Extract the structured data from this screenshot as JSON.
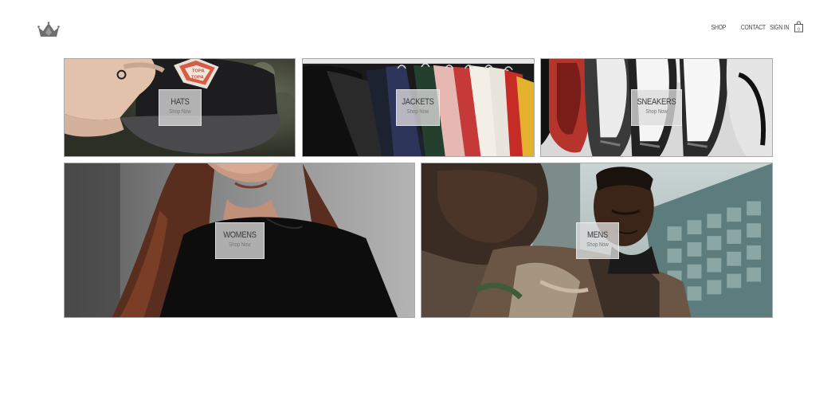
{
  "brand": {
    "logo_icon": "crown-icon"
  },
  "nav": {
    "shop": "SHOP",
    "contact": "CONTACT",
    "sign_in": "SIGN IN",
    "cart_icon": "shopping-bag-icon",
    "cart_count": "0"
  },
  "categories": [
    {
      "title": "HATS",
      "cta": "Shop Now",
      "badge_text": [
        "TOPA",
        "TOPA"
      ]
    },
    {
      "title": "JACKETS",
      "cta": "Shop Now"
    },
    {
      "title": "SNEAKERS",
      "cta": "Shop Now"
    },
    {
      "title": "WOMENS",
      "cta": "Shop Now"
    },
    {
      "title": "MENS",
      "cta": "Shop Now"
    }
  ]
}
